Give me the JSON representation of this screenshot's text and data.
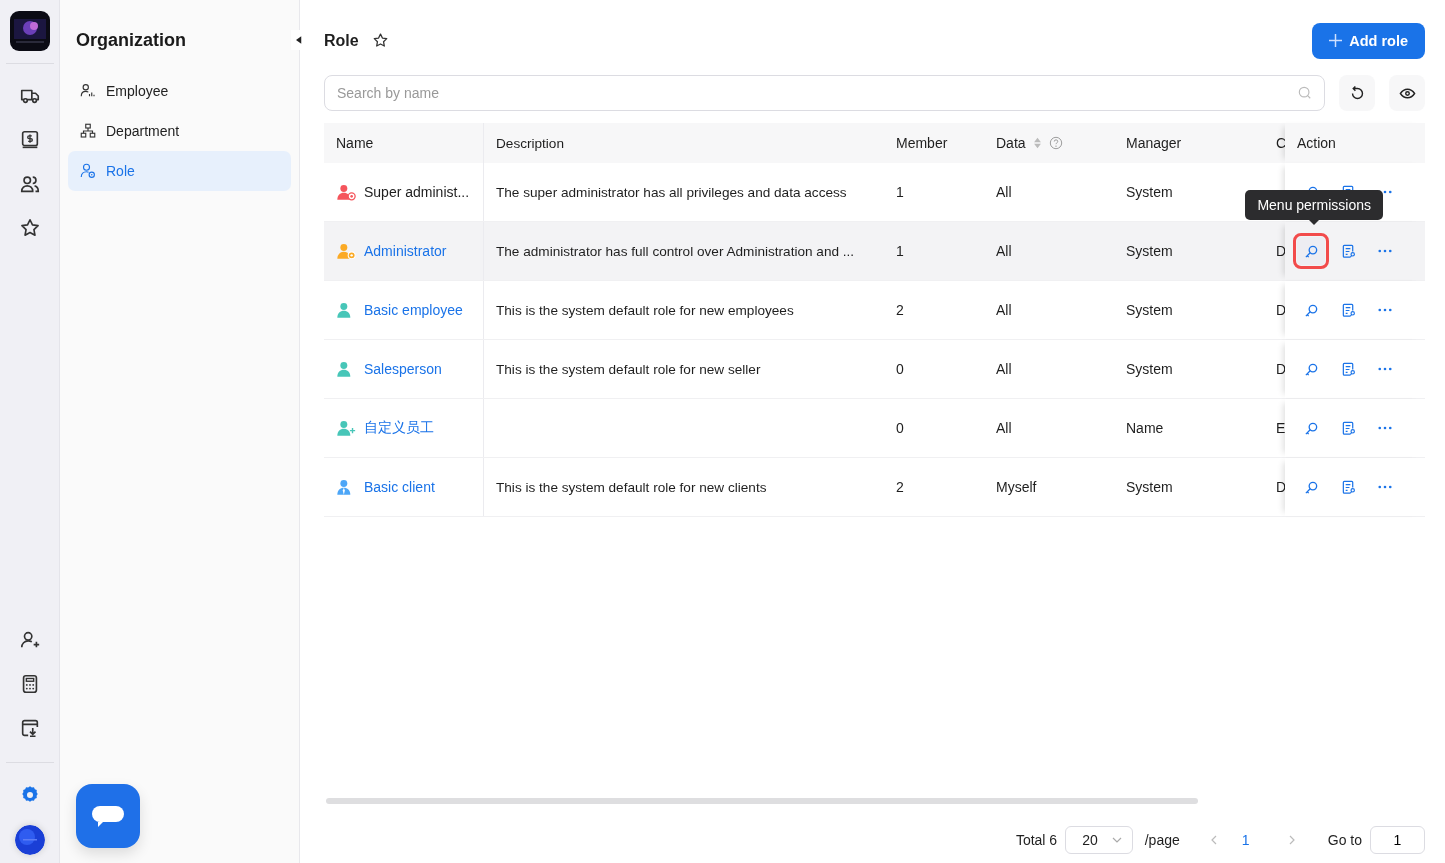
{
  "rail": {
    "top_items": [
      {
        "kind": "truck",
        "selected": false
      },
      {
        "kind": "money-book",
        "selected": false
      },
      {
        "kind": "users",
        "selected": false
      },
      {
        "kind": "star",
        "selected": false
      }
    ],
    "bottom_items": [
      {
        "kind": "user-plus",
        "selected": false
      },
      {
        "kind": "calculator",
        "selected": false
      },
      {
        "kind": "download-box",
        "selected": false
      },
      {
        "kind": "gear",
        "selected": true
      }
    ]
  },
  "sidebar": {
    "title": "Organization",
    "items": [
      {
        "label": "Employee",
        "kind": "employee",
        "selected": false
      },
      {
        "label": "Department",
        "kind": "department",
        "selected": false
      },
      {
        "label": "Role",
        "kind": "role",
        "selected": true
      }
    ]
  },
  "header": {
    "title": "Role",
    "starred": false,
    "add_button": "Add role"
  },
  "search": {
    "placeholder": "Search by name"
  },
  "table": {
    "columns": [
      "Name",
      "Description",
      "Member",
      "Data",
      "Manager",
      "C",
      "Action"
    ],
    "rows": [
      {
        "name": "Super administ...",
        "kind": "super",
        "color": "#f5555c",
        "link": false,
        "hovered": false,
        "description": "The super administrator has all privileges and data access",
        "member": "1",
        "data": "All",
        "manager": "System",
        "column_6": "",
        "key_highlighted": false
      },
      {
        "name": "Administrator",
        "kind": "admin",
        "color": "#fbaa25",
        "link": true,
        "hovered": true,
        "description": "The administrator has full control over Administration and ...",
        "member": "1",
        "data": "All",
        "manager": "System",
        "column_6": "D",
        "key_highlighted": true
      },
      {
        "name": "Basic employee",
        "kind": "basic",
        "color": "#47c6b8",
        "link": true,
        "hovered": false,
        "description": "This is the system default role for new employees",
        "member": "2",
        "data": "All",
        "manager": "System",
        "column_6": "D",
        "key_highlighted": false
      },
      {
        "name": "Salesperson",
        "kind": "basic",
        "color": "#47c6b8",
        "link": true,
        "hovered": false,
        "description": "This is the system default role for new seller",
        "member": "0",
        "data": "All",
        "manager": "System",
        "column_6": "D",
        "key_highlighted": false
      },
      {
        "name": "自定义员工",
        "kind": "custom",
        "color": "#47c6b8",
        "link": true,
        "hovered": false,
        "description": "",
        "member": "0",
        "data": "All",
        "manager": "Name",
        "column_6": "E",
        "key_highlighted": false
      },
      {
        "name": "Basic client",
        "kind": "client",
        "color": "#4da6f7",
        "link": true,
        "hovered": false,
        "description": "This is the system default role for new clients",
        "member": "2",
        "data": "Myself",
        "manager": "System",
        "column_6": "D",
        "key_highlighted": false
      }
    ]
  },
  "tooltip": {
    "text": "Menu permissions"
  },
  "pagination": {
    "total": "Total 6",
    "page_size": "20",
    "per_page": "/page",
    "pages": [
      {
        "label": "1",
        "selected": true
      }
    ],
    "goto_label": "Go to",
    "goto_value": "1"
  }
}
